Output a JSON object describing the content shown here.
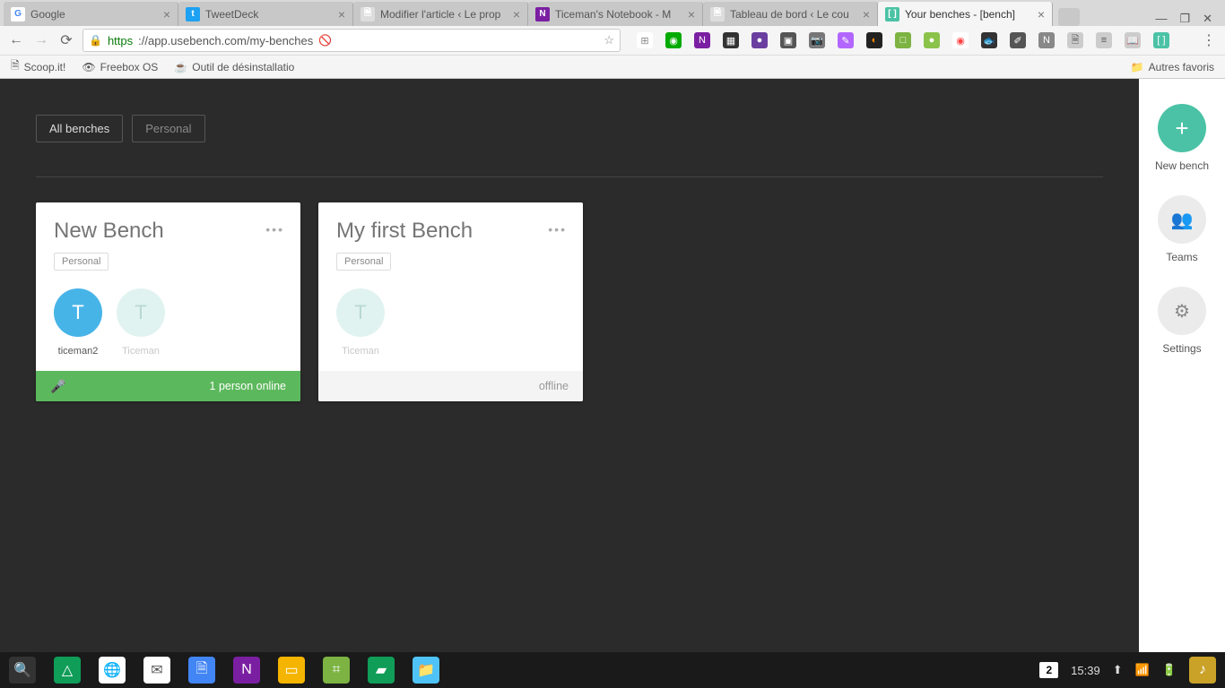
{
  "browser": {
    "tabs": [
      {
        "title": "Google",
        "favicon": "G",
        "color": "#fff",
        "active": false
      },
      {
        "title": "TweetDeck",
        "favicon": "t",
        "color": "#1da1f2",
        "active": false
      },
      {
        "title": "Modifier l'article ‹ Le prop",
        "favicon": "🗎",
        "color": "#ddd",
        "active": false
      },
      {
        "title": "Ticeman's Notebook - M",
        "favicon": "N",
        "color": "#7b1fa2",
        "active": false
      },
      {
        "title": "Tableau de bord ‹ Le cou",
        "favicon": "🗎",
        "color": "#ddd",
        "active": false
      },
      {
        "title": "Your benches - [bench]",
        "favicon": "[ ]",
        "color": "#4bc2a5",
        "active": true
      }
    ],
    "address": {
      "scheme": "https",
      "host": "://app.usebench.com",
      "path": "/my-benches"
    },
    "bookmarks": [
      {
        "label": "Scoop.it!",
        "icon": "🗎"
      },
      {
        "label": "Freebox OS",
        "icon": "👁"
      },
      {
        "label": "Outil de désinstallatio",
        "icon": "☕"
      }
    ],
    "other_bookmarks": "Autres favoris"
  },
  "filters": [
    {
      "label": "All benches",
      "active": true
    },
    {
      "label": "Personal",
      "active": false
    }
  ],
  "cards": [
    {
      "title": "New Bench",
      "tag": "Personal",
      "members": [
        {
          "initial": "T",
          "name": "ticeman2",
          "style": "blue"
        },
        {
          "initial": "T",
          "name": "Ticeman",
          "style": "pale"
        }
      ],
      "footer": {
        "type": "online",
        "text": "1 person online"
      }
    },
    {
      "title": "My first Bench",
      "tag": "Personal",
      "members": [
        {
          "initial": "T",
          "name": "Ticeman",
          "style": "pale"
        }
      ],
      "footer": {
        "type": "offline",
        "text": "offline"
      }
    }
  ],
  "rail": [
    {
      "label": "New bench",
      "icon": "+",
      "cls": "plus"
    },
    {
      "label": "Teams",
      "icon": "👥",
      "cls": "grey"
    },
    {
      "label": "Settings",
      "icon": "⚙",
      "cls": "grey"
    }
  ],
  "ext_icons": [
    {
      "bg": "#fff",
      "ch": "⊞",
      "fg": "#888"
    },
    {
      "bg": "#0a0",
      "ch": "◉",
      "fg": "#fff"
    },
    {
      "bg": "#7b1fa2",
      "ch": "N",
      "fg": "#fff"
    },
    {
      "bg": "#333",
      "ch": "▦",
      "fg": "#fff"
    },
    {
      "bg": "#6b3fa0",
      "ch": "●",
      "fg": "#fff"
    },
    {
      "bg": "#555",
      "ch": "▣",
      "fg": "#fff"
    },
    {
      "bg": "#777",
      "ch": "📷",
      "fg": "#fff"
    },
    {
      "bg": "#b266ff",
      "ch": "✎",
      "fg": "#fff"
    },
    {
      "bg": "#222",
      "ch": "◐",
      "fg": "#f80"
    },
    {
      "bg": "#7cb342",
      "ch": "□",
      "fg": "#fff"
    },
    {
      "bg": "#8bc34a",
      "ch": "●",
      "fg": "#fff"
    },
    {
      "bg": "#fff",
      "ch": "◉",
      "fg": "#f44"
    },
    {
      "bg": "#333",
      "ch": "🐟",
      "fg": "#fff"
    },
    {
      "bg": "#555",
      "ch": "✐",
      "fg": "#fff"
    },
    {
      "bg": "#888",
      "ch": "N",
      "fg": "#fff"
    },
    {
      "bg": "#ccc",
      "ch": "🗎",
      "fg": "#555"
    },
    {
      "bg": "#ccc",
      "ch": "≡",
      "fg": "#555"
    },
    {
      "bg": "#ccc",
      "ch": "📖",
      "fg": "#555"
    },
    {
      "bg": "#4bc2a5",
      "ch": "[ ]",
      "fg": "#fff"
    }
  ],
  "taskbar": {
    "apps": [
      {
        "bg": "#333",
        "ch": "🔍"
      },
      {
        "bg": "#0f9d58",
        "ch": "△"
      },
      {
        "bg": "#fff",
        "ch": "🌐"
      },
      {
        "bg": "#fff",
        "ch": "✉"
      },
      {
        "bg": "#4285f4",
        "ch": "🗎"
      },
      {
        "bg": "#7b1fa2",
        "ch": "N"
      },
      {
        "bg": "#f4b400",
        "ch": "▭"
      },
      {
        "bg": "#7cb342",
        "ch": "⌗"
      },
      {
        "bg": "#0f9d58",
        "ch": "▰"
      },
      {
        "bg": "#4fc3f7",
        "ch": "📁"
      }
    ],
    "badge": "2",
    "time": "15:39"
  }
}
